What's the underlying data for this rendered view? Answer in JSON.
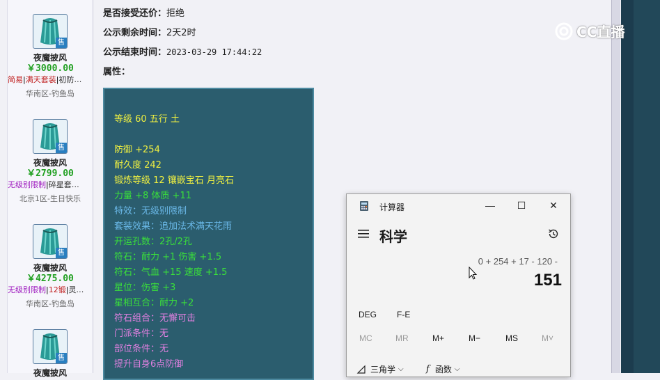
{
  "items": [
    {
      "name": "夜魔披风",
      "price": "￥3000.00",
      "tags": [
        {
          "text": "简易",
          "color": "#c02020"
        },
        {
          "text": "|",
          "color": "#333333"
        },
        {
          "text": "满天套装",
          "color": "#c02020"
        },
        {
          "text": "|",
          "color": "#333333"
        },
        {
          "text": "初防…",
          "color": "#333333"
        }
      ],
      "server": "华南区-钓鱼岛",
      "badge": "售"
    },
    {
      "name": "夜魔披风",
      "price": "￥2799.00",
      "tags": [
        {
          "text": "无级别限制",
          "color": "#a020c0"
        },
        {
          "text": "|",
          "color": "#333333"
        },
        {
          "text": "碎星套…",
          "color": "#333333"
        }
      ],
      "server": "北京1区-生日快乐",
      "badge": "售"
    },
    {
      "name": "夜魔披风",
      "price": "￥4275.00",
      "tags": [
        {
          "text": "无级别限制",
          "color": "#a020c0"
        },
        {
          "text": "|",
          "color": "#333333"
        },
        {
          "text": "12锻",
          "color": "#c02020"
        },
        {
          "text": "|",
          "color": "#333333"
        },
        {
          "text": "灵…",
          "color": "#333333"
        }
      ],
      "server": "华南区-钓鱼岛",
      "badge": "售"
    },
    {
      "name": "夜魔披风",
      "price": "",
      "tags": [],
      "server": "",
      "badge": "售"
    }
  ],
  "details": {
    "accept_counter": {
      "label": "是否接受还价：",
      "value": "拒绝"
    },
    "remaining": {
      "label": "公示剩余时间：",
      "value": "2天2时"
    },
    "end_time": {
      "label": "公示结束时间：",
      "value": "2023-03-29 17:44:22"
    },
    "attributes_label": "属性："
  },
  "attributes": [
    {
      "text": "等级 60 五行 土",
      "color": "#f0f040"
    },
    {
      "text": "防御 +254",
      "color": "#f0f040"
    },
    {
      "text": "耐久度 242",
      "color": "#f0f040"
    },
    {
      "text": "锻炼等级 12 镶嵌宝石 月亮石",
      "color": "#f0f040"
    },
    {
      "text": "力量 +8 体质 +11",
      "color": "#3ae03a"
    },
    {
      "text": "特效：无级别限制",
      "color": "#6ab8e8"
    },
    {
      "text": "套装效果：追加法术满天花雨",
      "color": "#6ab8e8"
    },
    {
      "text": "开运孔数：2孔/2孔",
      "color": "#3ae03a"
    },
    {
      "text": "符石：耐力 +1 伤害 +1.5",
      "color": "#3ae03a"
    },
    {
      "text": "符石：气血 +15 速度 +1.5",
      "color": "#3ae03a"
    },
    {
      "text": "星位：伤害 +3",
      "color": "#3ae03a"
    },
    {
      "text": "星相互合：耐力 +2",
      "color": "#3ae03a"
    },
    {
      "text": "符石组合：无懈可击",
      "color": "#e080e0"
    },
    {
      "text": "门派条件：无",
      "color": "#e080e0"
    },
    {
      "text": "部位条件：无",
      "color": "#e080e0"
    },
    {
      "text": "提升自身6点防御",
      "color": "#e080e0"
    }
  ],
  "watermark": "CC直播",
  "calculator": {
    "title": "计算器",
    "mode": "科学",
    "expression": "0 + 254 + 17 - 120 -",
    "result": "151",
    "angle_buttons": [
      "DEG",
      "F-E"
    ],
    "memory_buttons": [
      {
        "label": "MC",
        "enabled": false
      },
      {
        "label": "MR",
        "enabled": false
      },
      {
        "label": "M+",
        "enabled": true
      },
      {
        "label": "M−",
        "enabled": true
      },
      {
        "label": "MS",
        "enabled": true
      },
      {
        "label": "M˅",
        "enabled": false
      }
    ],
    "menus": [
      "三角学",
      "函数"
    ],
    "window_controls": {
      "minimize": "—",
      "maximize": "☐",
      "close": "✕"
    }
  }
}
